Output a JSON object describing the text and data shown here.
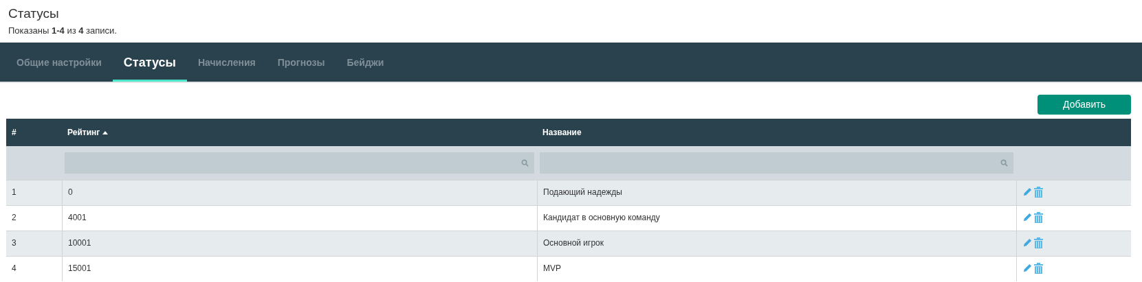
{
  "page": {
    "title": "Статусы",
    "summary": "Показаны **1-4** из **4** записи."
  },
  "tabs": [
    {
      "label": "Общие настройки",
      "selected": false
    },
    {
      "label": "Статусы",
      "selected": true
    },
    {
      "label": "Начисления",
      "selected": false
    },
    {
      "label": "Прогнозы",
      "selected": false
    },
    {
      "label": "Бейджи",
      "selected": false
    }
  ],
  "add_button": "Добавить",
  "table": {
    "columns": [
      {
        "label": "#"
      },
      {
        "label": "Рейтинг",
        "sorted": true,
        "filter": true
      },
      {
        "label": "Название",
        "filter": true
      }
    ],
    "rows": [
      {
        "cells": [
          "1",
          "0",
          "Подающий надежды"
        ]
      },
      {
        "cells": [
          "2",
          "4001",
          "Кандидат в основную команду"
        ]
      },
      {
        "cells": [
          "3",
          "10001",
          "Основной игрок"
        ]
      },
      {
        "cells": [
          "4",
          "15001",
          "MVP"
        ]
      }
    ]
  }
}
